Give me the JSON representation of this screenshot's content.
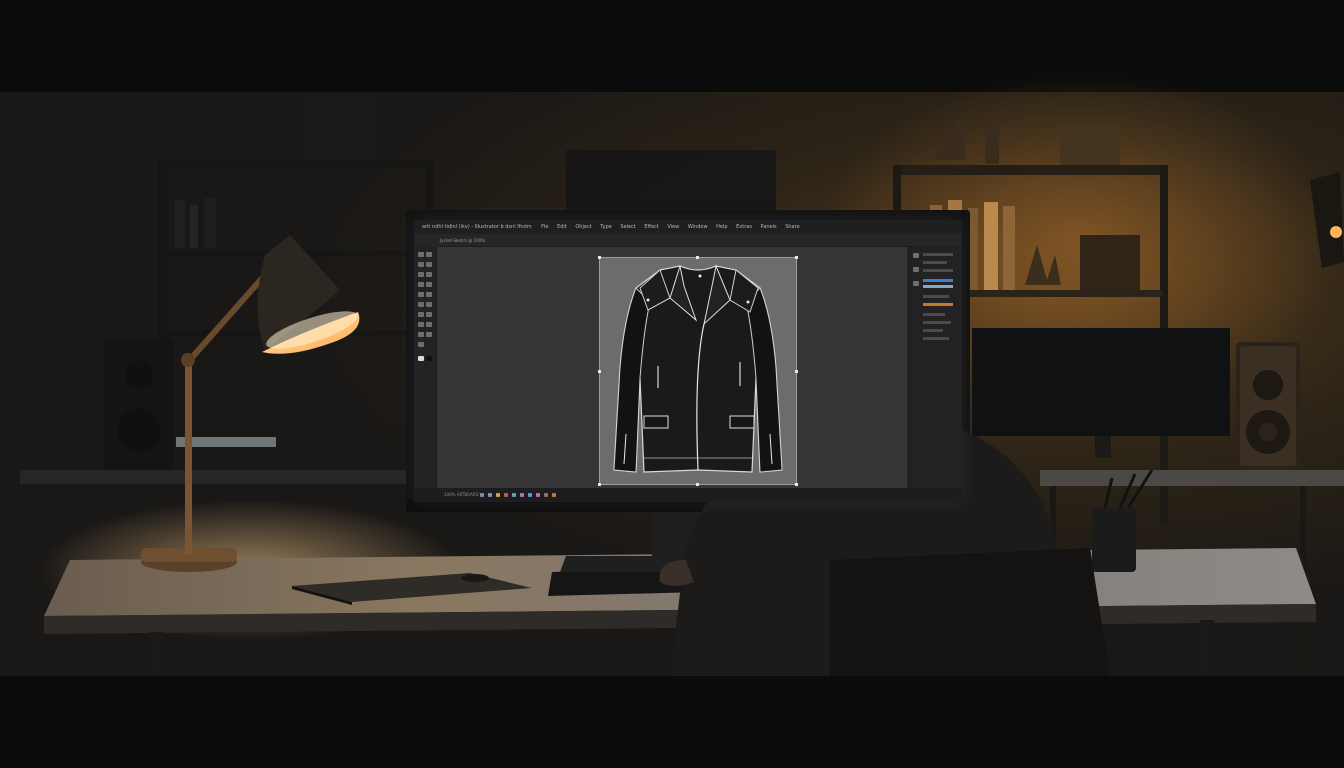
{
  "screen": {
    "title": "arti ndhl tidlnl (ikv) - Illustrator b dsnl lfndm",
    "menu": [
      "Fle",
      "Edit",
      "Ohject",
      "Type",
      "Select",
      "Effect",
      "View",
      "Window",
      "Help",
      "Extras",
      "Panels",
      "Share"
    ],
    "doc_tab": "Jacket-Sketch @ 100%",
    "status": "100% ARTBOARD"
  },
  "colors": {
    "lamp_glow": "#ffb766",
    "room_warm": "#6b4a22",
    "ui_dark": "#2b2b2d",
    "accent_orange": "#c8782a",
    "accent_blue": "#3a7fd1"
  }
}
